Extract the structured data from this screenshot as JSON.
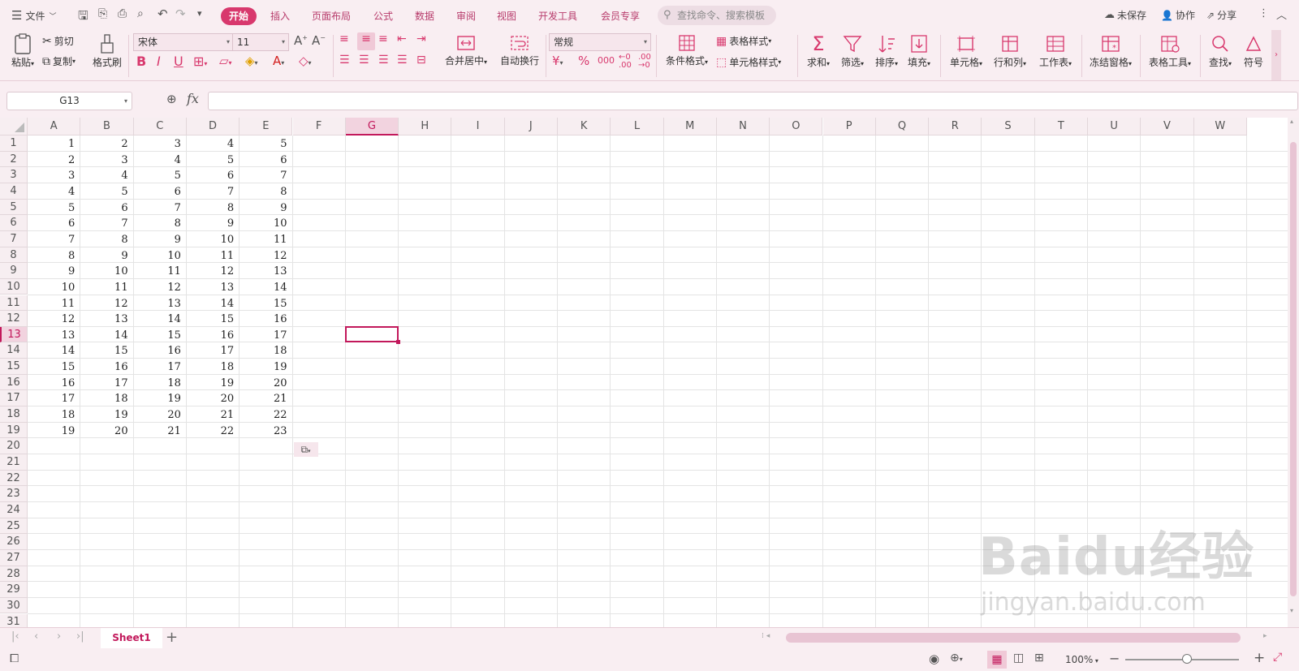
{
  "menubar": {
    "file_label": "文件",
    "tabs": [
      {
        "label": "开始",
        "active": true
      },
      {
        "label": "插入"
      },
      {
        "label": "页面布局"
      },
      {
        "label": "公式"
      },
      {
        "label": "数据"
      },
      {
        "label": "审阅"
      },
      {
        "label": "视图"
      },
      {
        "label": "开发工具"
      },
      {
        "label": "会员专享"
      }
    ],
    "search_placeholder": "查找命令、搜索模板",
    "unsaved_label": "未保存",
    "collab_label": "协作",
    "share_label": "分享"
  },
  "ribbon": {
    "paste": "粘贴",
    "cut": "剪切",
    "copy": "复制",
    "format_painter": "格式刷",
    "font_name": "宋体",
    "font_size": "11",
    "merge_center": "合并居中",
    "wrap_text": "自动换行",
    "number_format": "常规",
    "conditional_format": "条件格式",
    "table_style": "表格样式",
    "cell_style": "单元格样式",
    "sum": "求和",
    "filter": "筛选",
    "sort": "排序",
    "fill": "填充",
    "cell": "单元格",
    "row_col": "行和列",
    "worksheet": "工作表",
    "freeze": "冻结窗格",
    "table_tools": "表格工具",
    "find": "查找",
    "symbol": "符号"
  },
  "formula_bar": {
    "name_box": "G13",
    "fx_label": "fx",
    "formula": ""
  },
  "grid": {
    "columns": [
      "A",
      "B",
      "C",
      "D",
      "E",
      "F",
      "G",
      "H",
      "I",
      "J",
      "K",
      "L",
      "M",
      "N",
      "O",
      "P",
      "Q",
      "R",
      "S",
      "T",
      "U",
      "V",
      "W"
    ],
    "rows": [
      "1",
      "2",
      "3",
      "4",
      "5",
      "6",
      "7",
      "8",
      "9",
      "10",
      "11",
      "12",
      "13",
      "14",
      "15",
      "16",
      "17",
      "18",
      "19",
      "20",
      "21",
      "22",
      "23",
      "24",
      "25",
      "26",
      "27",
      "28",
      "29",
      "30",
      "31"
    ],
    "selected_cell": "G13",
    "data": [
      [
        1,
        2,
        3,
        4,
        5
      ],
      [
        2,
        3,
        4,
        5,
        6
      ],
      [
        3,
        4,
        5,
        6,
        7
      ],
      [
        4,
        5,
        6,
        7,
        8
      ],
      [
        5,
        6,
        7,
        8,
        9
      ],
      [
        6,
        7,
        8,
        9,
        10
      ],
      [
        7,
        8,
        9,
        10,
        11
      ],
      [
        8,
        9,
        10,
        11,
        12
      ],
      [
        9,
        10,
        11,
        12,
        13
      ],
      [
        10,
        11,
        12,
        13,
        14
      ],
      [
        11,
        12,
        13,
        14,
        15
      ],
      [
        12,
        13,
        14,
        15,
        16
      ],
      [
        13,
        14,
        15,
        16,
        17
      ],
      [
        14,
        15,
        16,
        17,
        18
      ],
      [
        15,
        16,
        17,
        18,
        19
      ],
      [
        16,
        17,
        18,
        19,
        20
      ],
      [
        17,
        18,
        19,
        20,
        21
      ],
      [
        18,
        19,
        20,
        21,
        22
      ],
      [
        19,
        20,
        21,
        22,
        23
      ]
    ]
  },
  "sheets": {
    "tabs": [
      "Sheet1"
    ],
    "active": "Sheet1"
  },
  "status": {
    "zoom": "100%"
  },
  "watermark": {
    "brand": "Baidu经验",
    "url": "jingyan.baidu.com"
  },
  "colors": {
    "accent": "#d8386d",
    "selection": "#c2185b",
    "background": "#f9eef2"
  }
}
